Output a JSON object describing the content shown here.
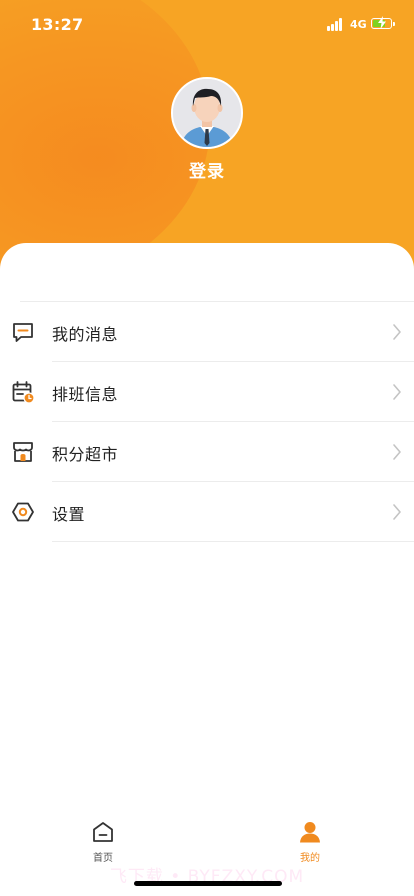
{
  "status_bar": {
    "time": "13:27",
    "network": "4G"
  },
  "profile": {
    "login_label": "登录"
  },
  "menu": [
    {
      "label": "我的消息",
      "icon": "message-icon"
    },
    {
      "label": "排班信息",
      "icon": "calendar-icon"
    },
    {
      "label": "积分超市",
      "icon": "store-icon"
    },
    {
      "label": "设置",
      "icon": "settings-icon"
    }
  ],
  "tabbar": {
    "home_label": "首页",
    "mine_label": "我的"
  },
  "watermark": "飞下载 • BYFZXY.COM",
  "colors": {
    "accent": "#f08a1f",
    "header": "#f7a424",
    "icon_dark": "#333333"
  }
}
